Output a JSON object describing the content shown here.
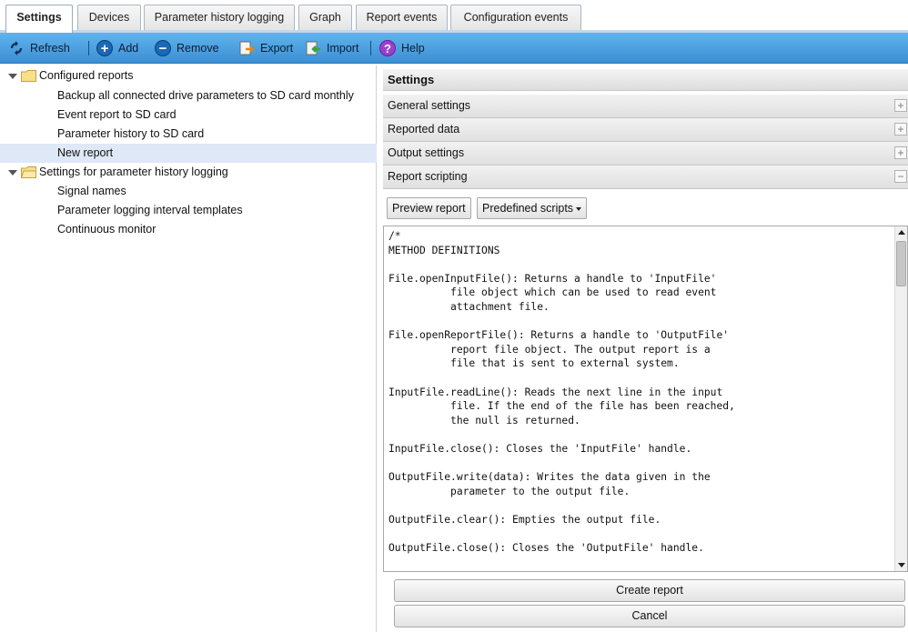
{
  "tabs": [
    {
      "label": "Settings",
      "active": true
    },
    {
      "label": "Devices",
      "active": false
    },
    {
      "label": "Parameter history logging",
      "active": false
    },
    {
      "label": "Graph",
      "active": false
    },
    {
      "label": "Report events",
      "active": false
    },
    {
      "label": "Configuration events",
      "active": false
    }
  ],
  "toolbar": {
    "refresh": "Refresh",
    "add": "Add",
    "remove": "Remove",
    "export": "Export",
    "import": "Import",
    "help": "Help",
    "refresh_icon": "refresh-icon",
    "add_icon": "add-icon",
    "remove_icon": "remove-icon",
    "export_icon": "export-icon",
    "import_icon": "import-icon",
    "help_icon": "help-icon"
  },
  "tree": {
    "groups": [
      {
        "label": "Configured reports",
        "items": [
          "Backup all connected drive parameters to SD card monthly",
          "Event report to SD card",
          "Parameter history to SD card",
          "New report"
        ]
      },
      {
        "label": "Settings for parameter history logging",
        "items": [
          "Signal names",
          "Parameter logging interval templates",
          "Continuous monitor"
        ]
      }
    ],
    "selected_item": "New report"
  },
  "panel": {
    "title": "Settings",
    "sections": [
      {
        "label": "General settings",
        "toggle": "+"
      },
      {
        "label": "Reported data",
        "toggle": "+"
      },
      {
        "label": "Output settings",
        "toggle": "+"
      },
      {
        "label": "Report scripting",
        "toggle": "−"
      }
    ],
    "preview_button": "Preview report",
    "scripts_dropdown": "Predefined scripts",
    "script_text": "/*\nMETHOD DEFINITIONS\n\nFile.openInputFile(): Returns a handle to 'InputFile'\n          file object which can be used to read event\n          attachment file.\n\nFile.openReportFile(): Returns a handle to 'OutputFile'\n          report file object. The output report is a\n          file that is sent to external system.\n\nInputFile.readLine(): Reads the next line in the input\n          file. If the end of the file has been reached,\n          the null is returned.\n\nInputFile.close(): Closes the 'InputFile' handle.\n\nOutputFile.write(data): Writes the data given in the\n          parameter to the output file.\n\nOutputFile.clear(): Empties the output file.\n\nOutputFile.close(): Closes the 'OutputFile' handle.",
    "create_button": "Create report",
    "cancel_button": "Cancel"
  },
  "colors": {
    "toolbar": "#4a9fe0",
    "selection": "#dfe8f6",
    "tab_accent": "#bfd8ee"
  }
}
